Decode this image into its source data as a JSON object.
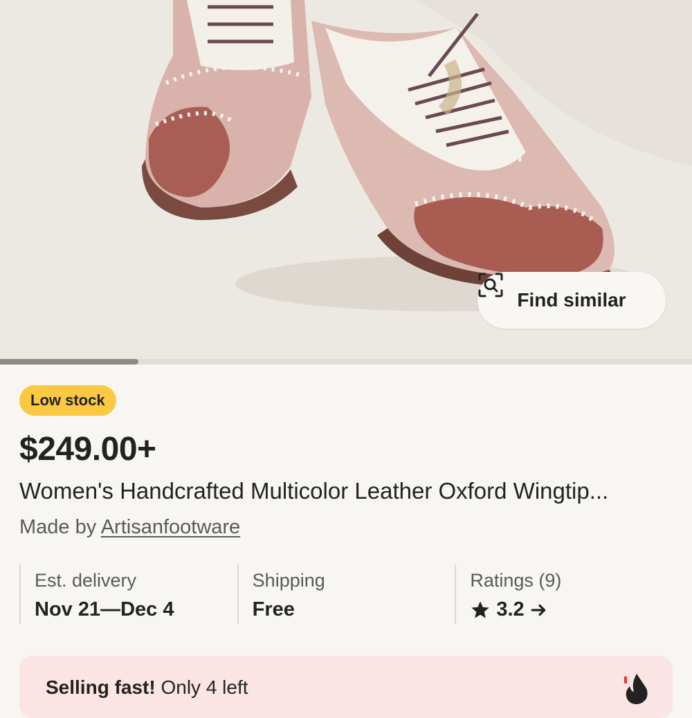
{
  "hero": {
    "find_similar_label": "Find similar",
    "find_similar_icon": "camera-search-icon",
    "image_progress": 0.2
  },
  "product": {
    "badge": "Low stock",
    "price": "$249.00+",
    "title": "Women's Handcrafted Multicolor Leather Oxford Wingtip...",
    "made_by_label": "Made by",
    "shop_name": "Artisanfootware"
  },
  "info": {
    "delivery_label": "Est. delivery",
    "delivery_value": "Nov 21—Dec 4",
    "shipping_label": "Shipping",
    "shipping_value": "Free",
    "ratings_label": "Ratings (9)",
    "ratings_value": "3.2",
    "ratings_star_icon": "star-icon",
    "ratings_arrow_icon": "arrow-right-icon"
  },
  "selling": {
    "bold": "Selling fast!",
    "rest": " Only 4 left",
    "icon": "fire-icon"
  },
  "colors": {
    "badge": "#fbc842",
    "background": "#f8f6f2",
    "selling_bg": "#fbe4e4",
    "text": "#222222",
    "muted": "#595959"
  }
}
